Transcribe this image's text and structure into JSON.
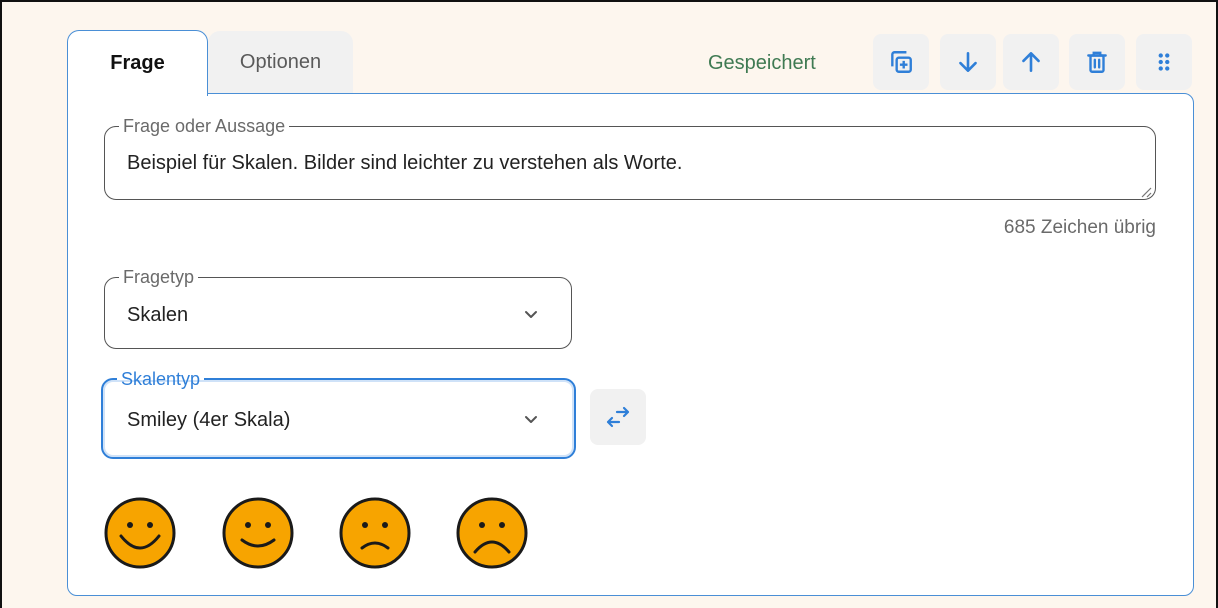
{
  "tabs": {
    "frage": "Frage",
    "optionen": "Optionen"
  },
  "toolbar": {
    "status": "Gespeichert",
    "icons": [
      "duplicate-icon",
      "arrow-down-icon",
      "arrow-up-icon",
      "trash-icon",
      "drag-handle-icon"
    ]
  },
  "question": {
    "label": "Frage oder Aussage",
    "value": "Beispiel für Skalen. Bilder sind leichter zu verstehen als Worte.",
    "counter": "685 Zeichen übrig"
  },
  "question_type": {
    "label": "Fragetyp",
    "value": "Skalen"
  },
  "scale_type": {
    "label": "Skalentyp",
    "value": "Smiley (4er Skala)"
  },
  "smileys": [
    "very-happy-face-icon",
    "happy-face-icon",
    "sad-face-icon",
    "very-sad-face-icon"
  ],
  "colors": {
    "accent": "#2f7fd8",
    "saved": "#3f7a52",
    "smiley_fill": "#f7a400",
    "border": "#4a8fd6"
  }
}
